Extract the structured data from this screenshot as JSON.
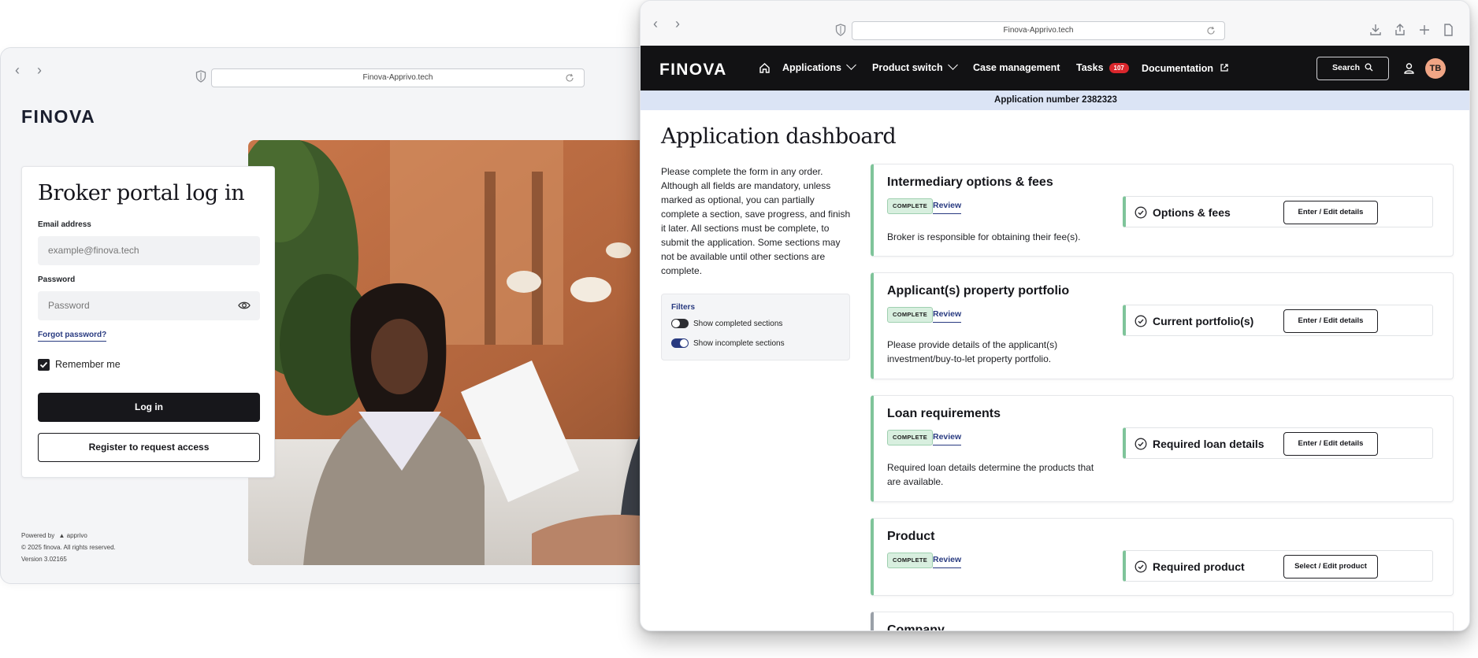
{
  "back_window": {
    "url": "Finova-Apprivo.tech",
    "logo": "FINOVA",
    "login": {
      "title": "Broker portal log in",
      "email_label": "Email address",
      "email_placeholder": "example@finova.tech",
      "password_label": "Password",
      "password_placeholder": "Password",
      "forgot_link": "Forgot password?",
      "remember_label": "Remember me",
      "remember_checked": true,
      "login_button": "Log in",
      "register_button": "Register to request access"
    },
    "footer": {
      "powered_by": "Powered by",
      "powered_brand": "apprivo",
      "copyright": "© 2025 finova. All rights reserved.",
      "version": "Version 3.02165"
    }
  },
  "front_window": {
    "url": "Finova-Apprivo.tech",
    "nav": {
      "logo": "FINOVA",
      "home_icon": "home-icon",
      "items": [
        "Applications",
        "Product switch",
        "Case management",
        "Tasks",
        "Documentation"
      ],
      "tasks_badge": "107",
      "search_label": "Search",
      "avatar_initials": "TB"
    },
    "app_number_bar": "Application number 2382323",
    "title": "Application dashboard",
    "description": "Please complete the form in any order. Although all fields are mandatory, unless marked as optional, you can partially complete a section, save progress, and finish it later. All sections must be complete, to submit the application. Some sections may not be available until other sections are complete.",
    "filters": {
      "title": "Filters",
      "show_completed": "Show completed sections",
      "show_completed_on": false,
      "show_incomplete": "Show incomplete sections",
      "show_incomplete_on": true
    },
    "sections": [
      {
        "title": "Intermediary options & fees",
        "status": "COMPLETE",
        "review": "Review",
        "description": "Broker is responsible for obtaining their fee(s).",
        "item_label": "Options & fees",
        "button": "Enter / Edit details"
      },
      {
        "title": "Applicant(s) property portfolio",
        "status": "COMPLETE",
        "review": "Review",
        "description": "Please provide details of the applicant(s) investment/buy-to-let property portfolio.",
        "item_label": "Current portfolio(s)",
        "button": "Enter / Edit details"
      },
      {
        "title": "Loan requirements",
        "status": "COMPLETE",
        "review": "Review",
        "description": "Required loan details determine the products that are available.",
        "item_label": "Required loan details",
        "button": "Enter / Edit details"
      },
      {
        "title": "Product",
        "status": "COMPLETE",
        "review": "Review",
        "description": "",
        "item_label": "Required product",
        "button": "Select / Edit product"
      },
      {
        "title": "Company"
      }
    ],
    "colors": {
      "nav_bg": "#121214",
      "app_bar_bg": "#dbe4f5",
      "complete_accent": "#7fc49a",
      "link": "#283a80",
      "badge": "#d9262c",
      "avatar": "#f0a585"
    }
  }
}
